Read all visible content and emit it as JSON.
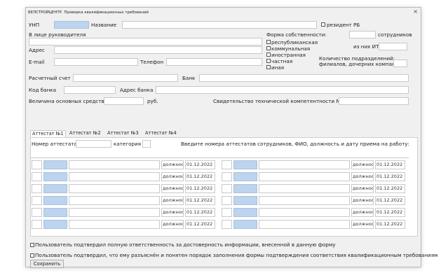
{
  "window": {
    "title": "БЕЛСТРОЙЦЕНТР. Проверка квалификационных требований",
    "close_glyph": "×"
  },
  "form": {
    "unp_label": "УНП",
    "name_label": "Название",
    "resident_label": "резидент РБ",
    "director_label": "В лице руководителя",
    "address_label": "Адрес",
    "email_label": "E-mail",
    "phone_label": "Телефон",
    "ownership_label": "Форма собственности:",
    "ownership_options": [
      "республиканская",
      "коммунальная",
      "иностранная",
      "частная",
      "иная"
    ],
    "employees_label": "сотрудников",
    "itr_label": "из них ИТР:",
    "branches_label_1": "Количество подразделений:",
    "branches_label_2": "филиалов, дочерних компаний:",
    "account_label": "Расчетный счет",
    "bank_label": "Банк",
    "bank_code_label": "Код банка",
    "bank_address_label": "Адрес банка",
    "fixed_assets_label": "Величина основных средств",
    "rub_label": "руб.",
    "certificate_label": "Свидетельство технической компетентности №"
  },
  "tabs": [
    {
      "label": "Аттестат №1",
      "active": true
    },
    {
      "label": "Аттестат №2",
      "active": false
    },
    {
      "label": "Аттестат №3",
      "active": false
    },
    {
      "label": "Аттестат №4",
      "active": false
    }
  ],
  "attestat": {
    "number_label": "Номер аттестата",
    "category_label": "категория",
    "instruction": "Введите номера аттестатов сотрудников, ФИО, должность и дату приема на работу:"
  },
  "employee_rows": [
    {
      "position": "должност",
      "date": "01.12.2022"
    },
    {
      "position": "должност",
      "date": "01.12.2022"
    },
    {
      "position": "должност",
      "date": "01.12.2022"
    },
    {
      "position": "должност",
      "date": "01.12.2022"
    },
    {
      "position": "должност",
      "date": "01.12.2022"
    },
    {
      "position": "должност",
      "date": "01.12.2022"
    }
  ],
  "agreements": [
    "Пользователь подтвердил полную ответственность за достоверность информации, внесенной в данную форму",
    "Пользователь подтвердил, что ему разъяснён и понятен порядок заполнения формы подтверждения соответствия квалификационным требованиям"
  ],
  "save_label": "Сохранить",
  "colors": {
    "accent_field": "#bcd4ee",
    "background": "#f0f0f0"
  }
}
